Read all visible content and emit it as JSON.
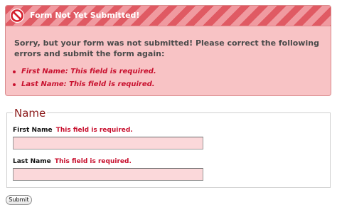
{
  "alert": {
    "title": "Form Not Yet Submitted!",
    "message": "Sorry, but your form was not submitted! Please correct the following errors and submit the form again:",
    "errors": [
      "First Name: This field is required.",
      "Last Name: This field is required."
    ],
    "icon": "ban-icon"
  },
  "fieldset": {
    "legend": "Name",
    "fields": [
      {
        "label": "First Name",
        "error": "This field is required.",
        "value": ""
      },
      {
        "label": "Last Name",
        "error": "This field is required.",
        "value": ""
      }
    ]
  },
  "submit": {
    "label": "Submit"
  },
  "colors": {
    "alert_background": "#f8c3c5",
    "alert_stripe_dark": "#e05a63",
    "alert_stripe_light": "#f09aa0",
    "error_text": "#c8102e",
    "legend_text": "#8b1a1a",
    "input_error_background": "#fbd8da"
  }
}
